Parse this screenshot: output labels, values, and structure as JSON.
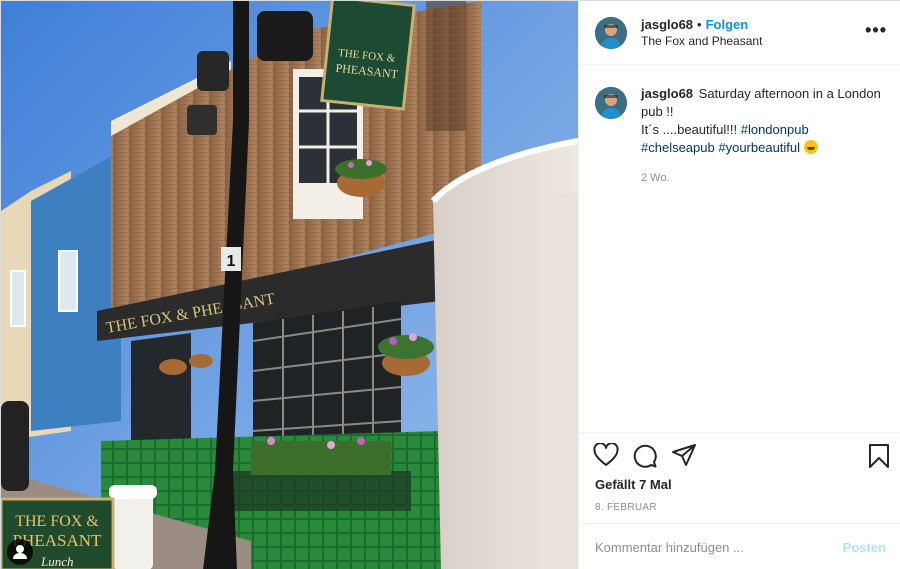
{
  "post": {
    "author": "jasglo68",
    "separator": "•",
    "follow_label": "Folgen",
    "location": "The Fox and Pheasant",
    "more_label": "•••",
    "caption_lines": {
      "line1": "Saturday afternoon in a London pub !!",
      "line2": "It´s ....beautiful!!! ",
      "tag1": "#londonpub",
      "tag2": "#chelseapub",
      "tag3": "#yourbeautiful"
    },
    "emoji": "grinning-face-with-sweat",
    "time_ago": "2 Wo.",
    "likes": "Gefällt 7 Mal",
    "date": "8. FEBRUAR"
  },
  "comment_box": {
    "placeholder": "Kommentar hinzufügen ...",
    "post_label": "Posten"
  },
  "photo": {
    "sign_top": "THE FOX & PHEASANT",
    "sign_fascia": "THE FOX & PHEASANT",
    "sign_board_line1": "THE FOX &",
    "sign_board_line2": "PHEASANT",
    "sign_board_extra": "Lunch",
    "lamp_number": "1"
  },
  "colors": {
    "accent": "#0095f6",
    "tag": "#00376b",
    "muted": "#8e8e8e",
    "post_disabled": "#b2dffc",
    "tile_green": "#1f7a34"
  },
  "icons": [
    "heart-icon",
    "comment-icon",
    "share-icon",
    "bookmark-icon",
    "more-icon",
    "user-icon"
  ]
}
